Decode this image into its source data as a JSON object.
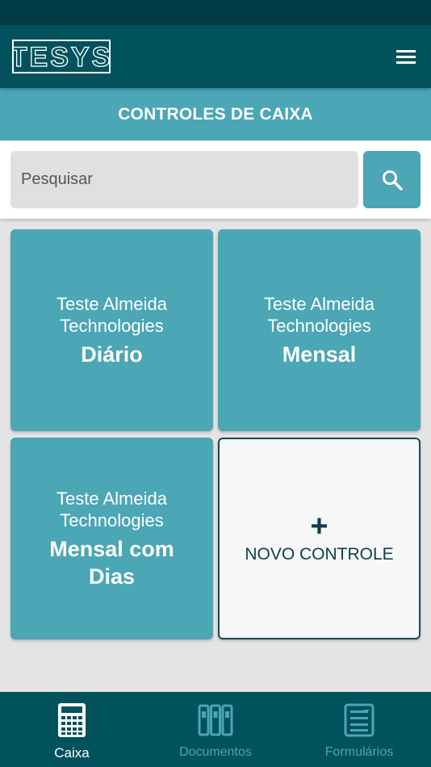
{
  "header": {
    "logo_text": "TESYS",
    "menu_icon": "hamburger-menu-icon"
  },
  "title": "CONTROLES DE CAIXA",
  "search": {
    "placeholder": "Pesquisar",
    "value": "",
    "button_icon": "search-icon"
  },
  "tiles": [
    {
      "company": "Teste Almeida Technologies",
      "period": "Diário"
    },
    {
      "company": "Teste Almeida Technologies",
      "period": "Mensal"
    },
    {
      "company": "Teste Almeida Technologies",
      "period": "Mensal com Dias"
    }
  ],
  "new_tile": {
    "plus": "+",
    "label": "NOVO CONTROLE"
  },
  "bottom_nav": [
    {
      "label": "Caixa",
      "icon": "calculator-icon",
      "active": true
    },
    {
      "label": "Documentos",
      "icon": "binders-icon",
      "active": false
    },
    {
      "label": "Formulários",
      "icon": "form-icon",
      "active": false
    }
  ],
  "colors": {
    "status_bar": "#003c45",
    "app_bar": "#01525d",
    "accent": "#4ba6b5",
    "background": "#e4e4e4"
  }
}
